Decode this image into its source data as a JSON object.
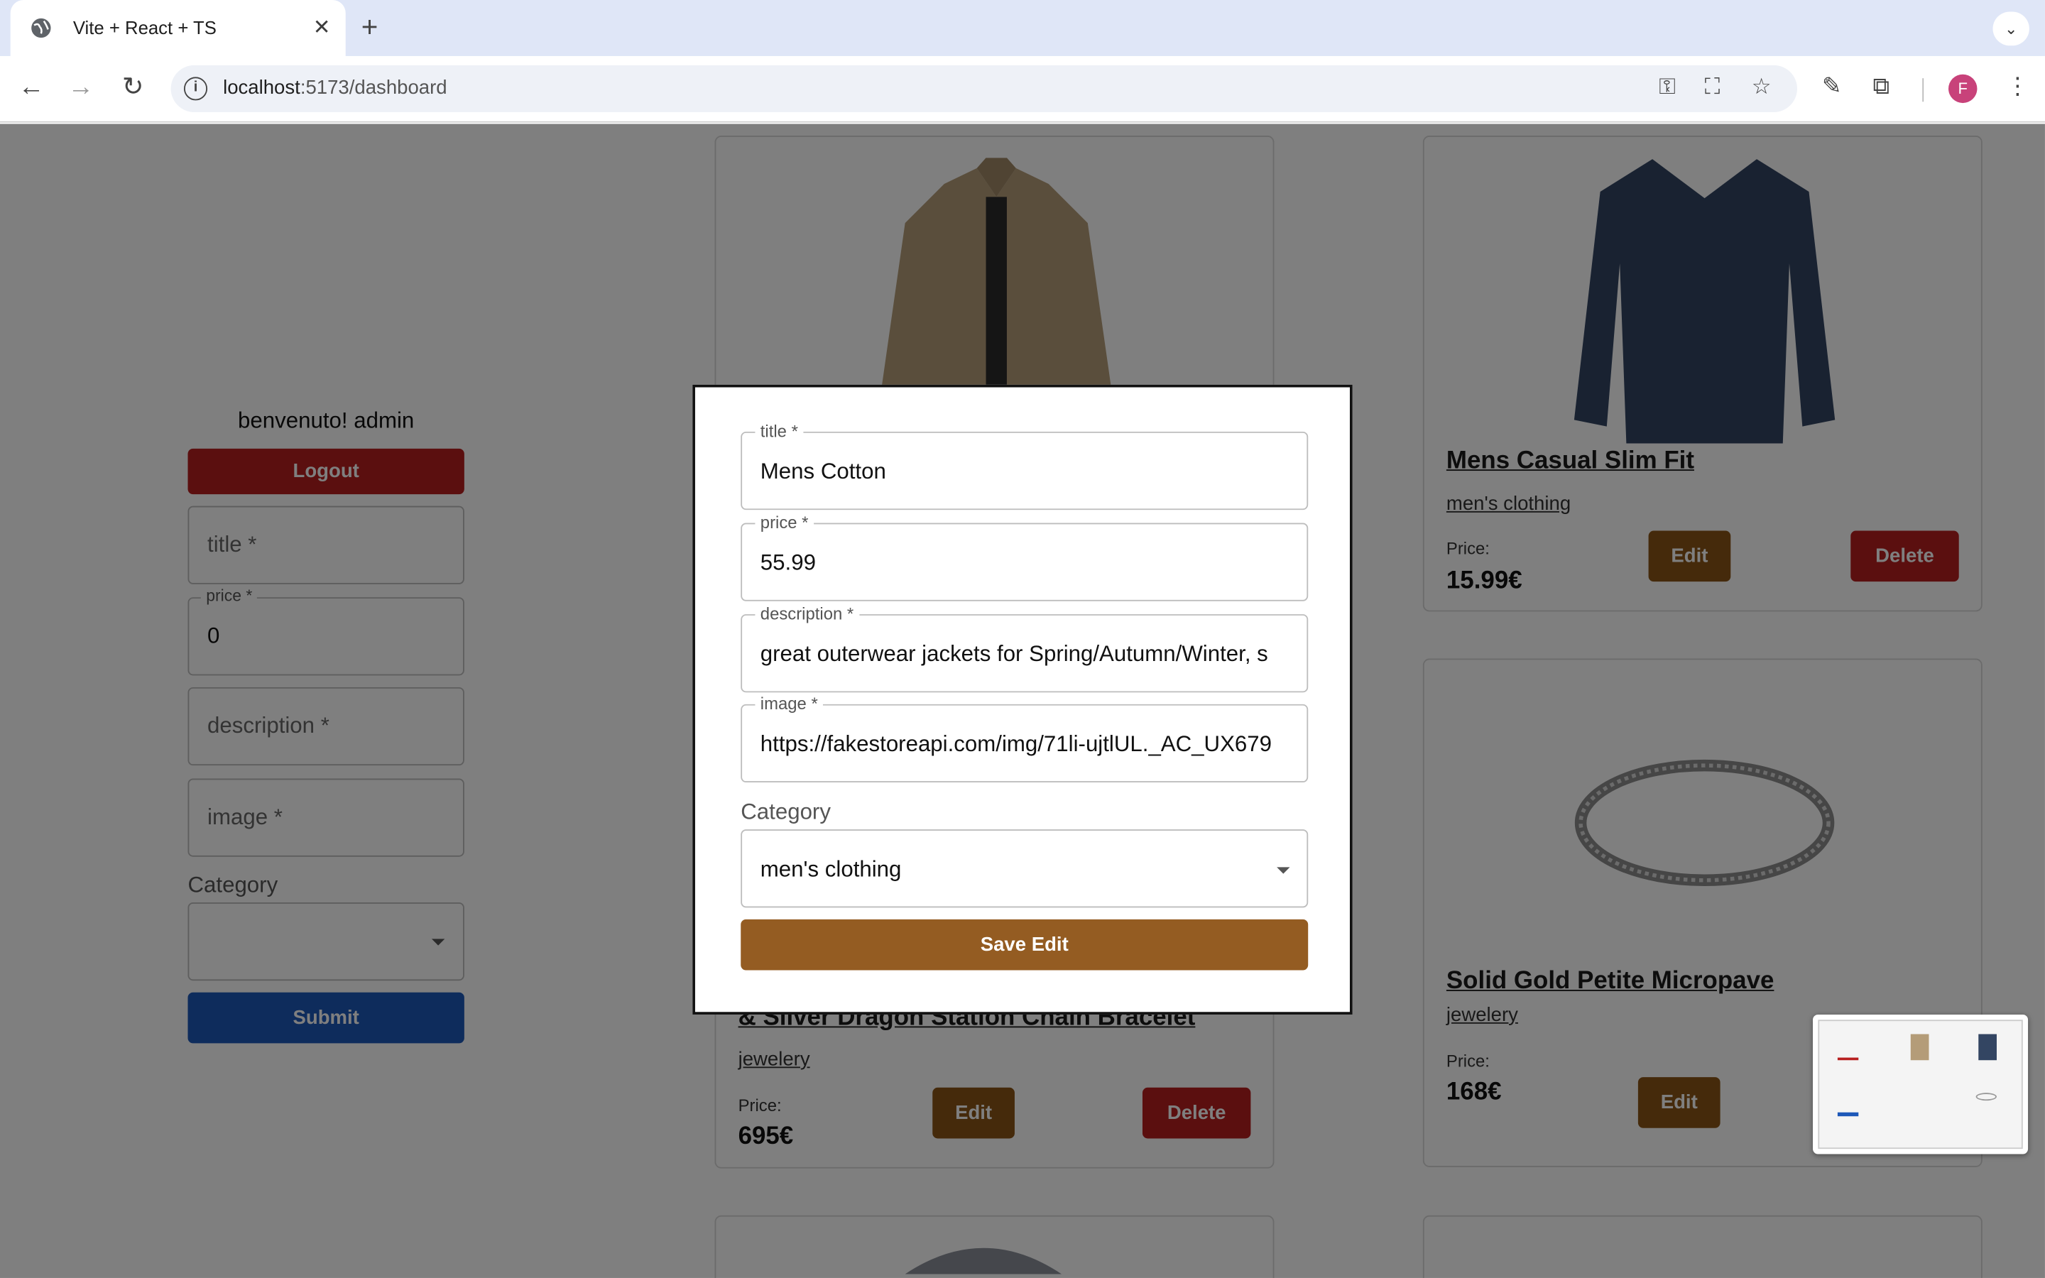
{
  "browser": {
    "tab_title": "Vite + React + TS",
    "url_host": "localhost",
    "url_rest": ":5173/dashboard",
    "avatar_letter": "F"
  },
  "sidebar": {
    "welcome": "benvenuto! admin",
    "logout_label": "Logout",
    "title_placeholder": "title *",
    "price_label": "price *",
    "price_value": "0",
    "description_placeholder": "description *",
    "image_placeholder": "image *",
    "category_label": "Category",
    "submit_label": "Submit"
  },
  "products": [
    {
      "name": "Mens Casual Slim Fit",
      "category": "men's clothing",
      "price_label": "Price:",
      "price": "15.99€",
      "edit": "Edit",
      "delete": "Delete"
    },
    {
      "name": "& Silver Dragon Station Chain Bracelet",
      "category": "jewelery",
      "price_label": "Price:",
      "price": "695€",
      "edit": "Edit",
      "delete": "Delete"
    },
    {
      "name": "Solid Gold Petite Micropave",
      "category": "jewelery",
      "price_label": "Price:",
      "price": "168€",
      "edit": "Edit"
    }
  ],
  "modal": {
    "title_label": "title *",
    "title_value": "Mens Cotton",
    "price_label": "price *",
    "price_value": "55.99",
    "description_label": "description *",
    "description_value": "great outerwear jackets for Spring/Autumn/Winter, s",
    "image_label": "image *",
    "image_value": "https://fakestoreapi.com/img/71li-ujtlUL._AC_UX679",
    "category_label": "Category",
    "category_value": "men's clothing",
    "save_label": "Save Edit"
  },
  "colors": {
    "logout": "#b71f1f",
    "submit": "#1d58b8",
    "edit": "#8a5516",
    "delete": "#b71f1f",
    "save_edit": "#945c22"
  }
}
